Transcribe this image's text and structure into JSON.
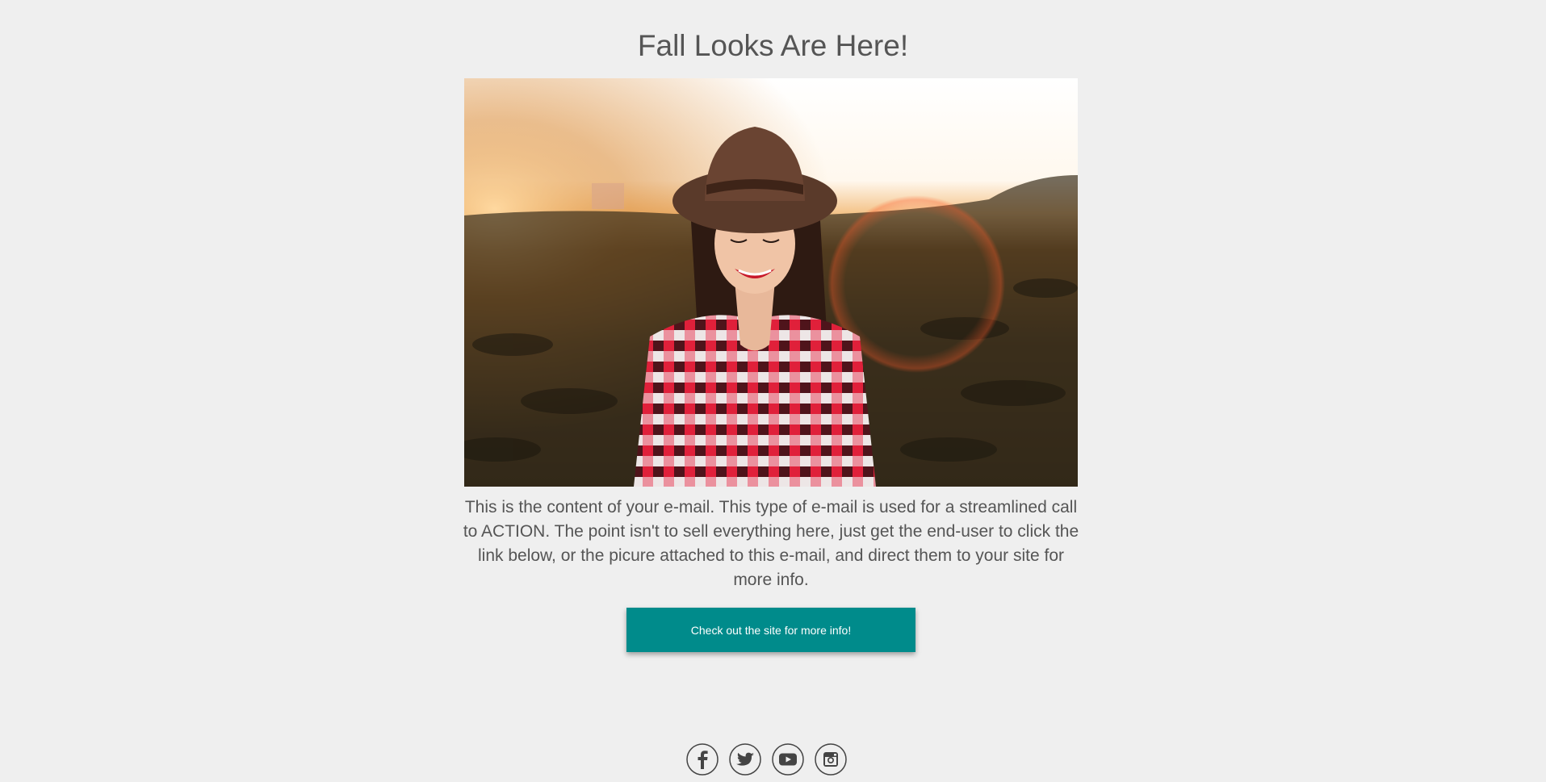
{
  "headline": "Fall Looks Are Here!",
  "body_text": "This is the content of your e-mail. This type of e-mail is used for a streamlined call to ACTION. The point isn't to sell everything here, just get the end-user to click the link below, or the picure attached to this e-mail, and direct them to your site for more info.",
  "cta_label": "Check out the site for more info!",
  "hero_image_alt": "Smiling woman in a hat and red plaid shirt standing in a field at sunset",
  "social": [
    {
      "name": "facebook-icon"
    },
    {
      "name": "twitter-icon"
    },
    {
      "name": "youtube-icon"
    },
    {
      "name": "instagram-icon"
    }
  ],
  "colors": {
    "background": "#efefef",
    "text": "#555555",
    "button": "#008b8b",
    "button_text": "#ffffff"
  }
}
